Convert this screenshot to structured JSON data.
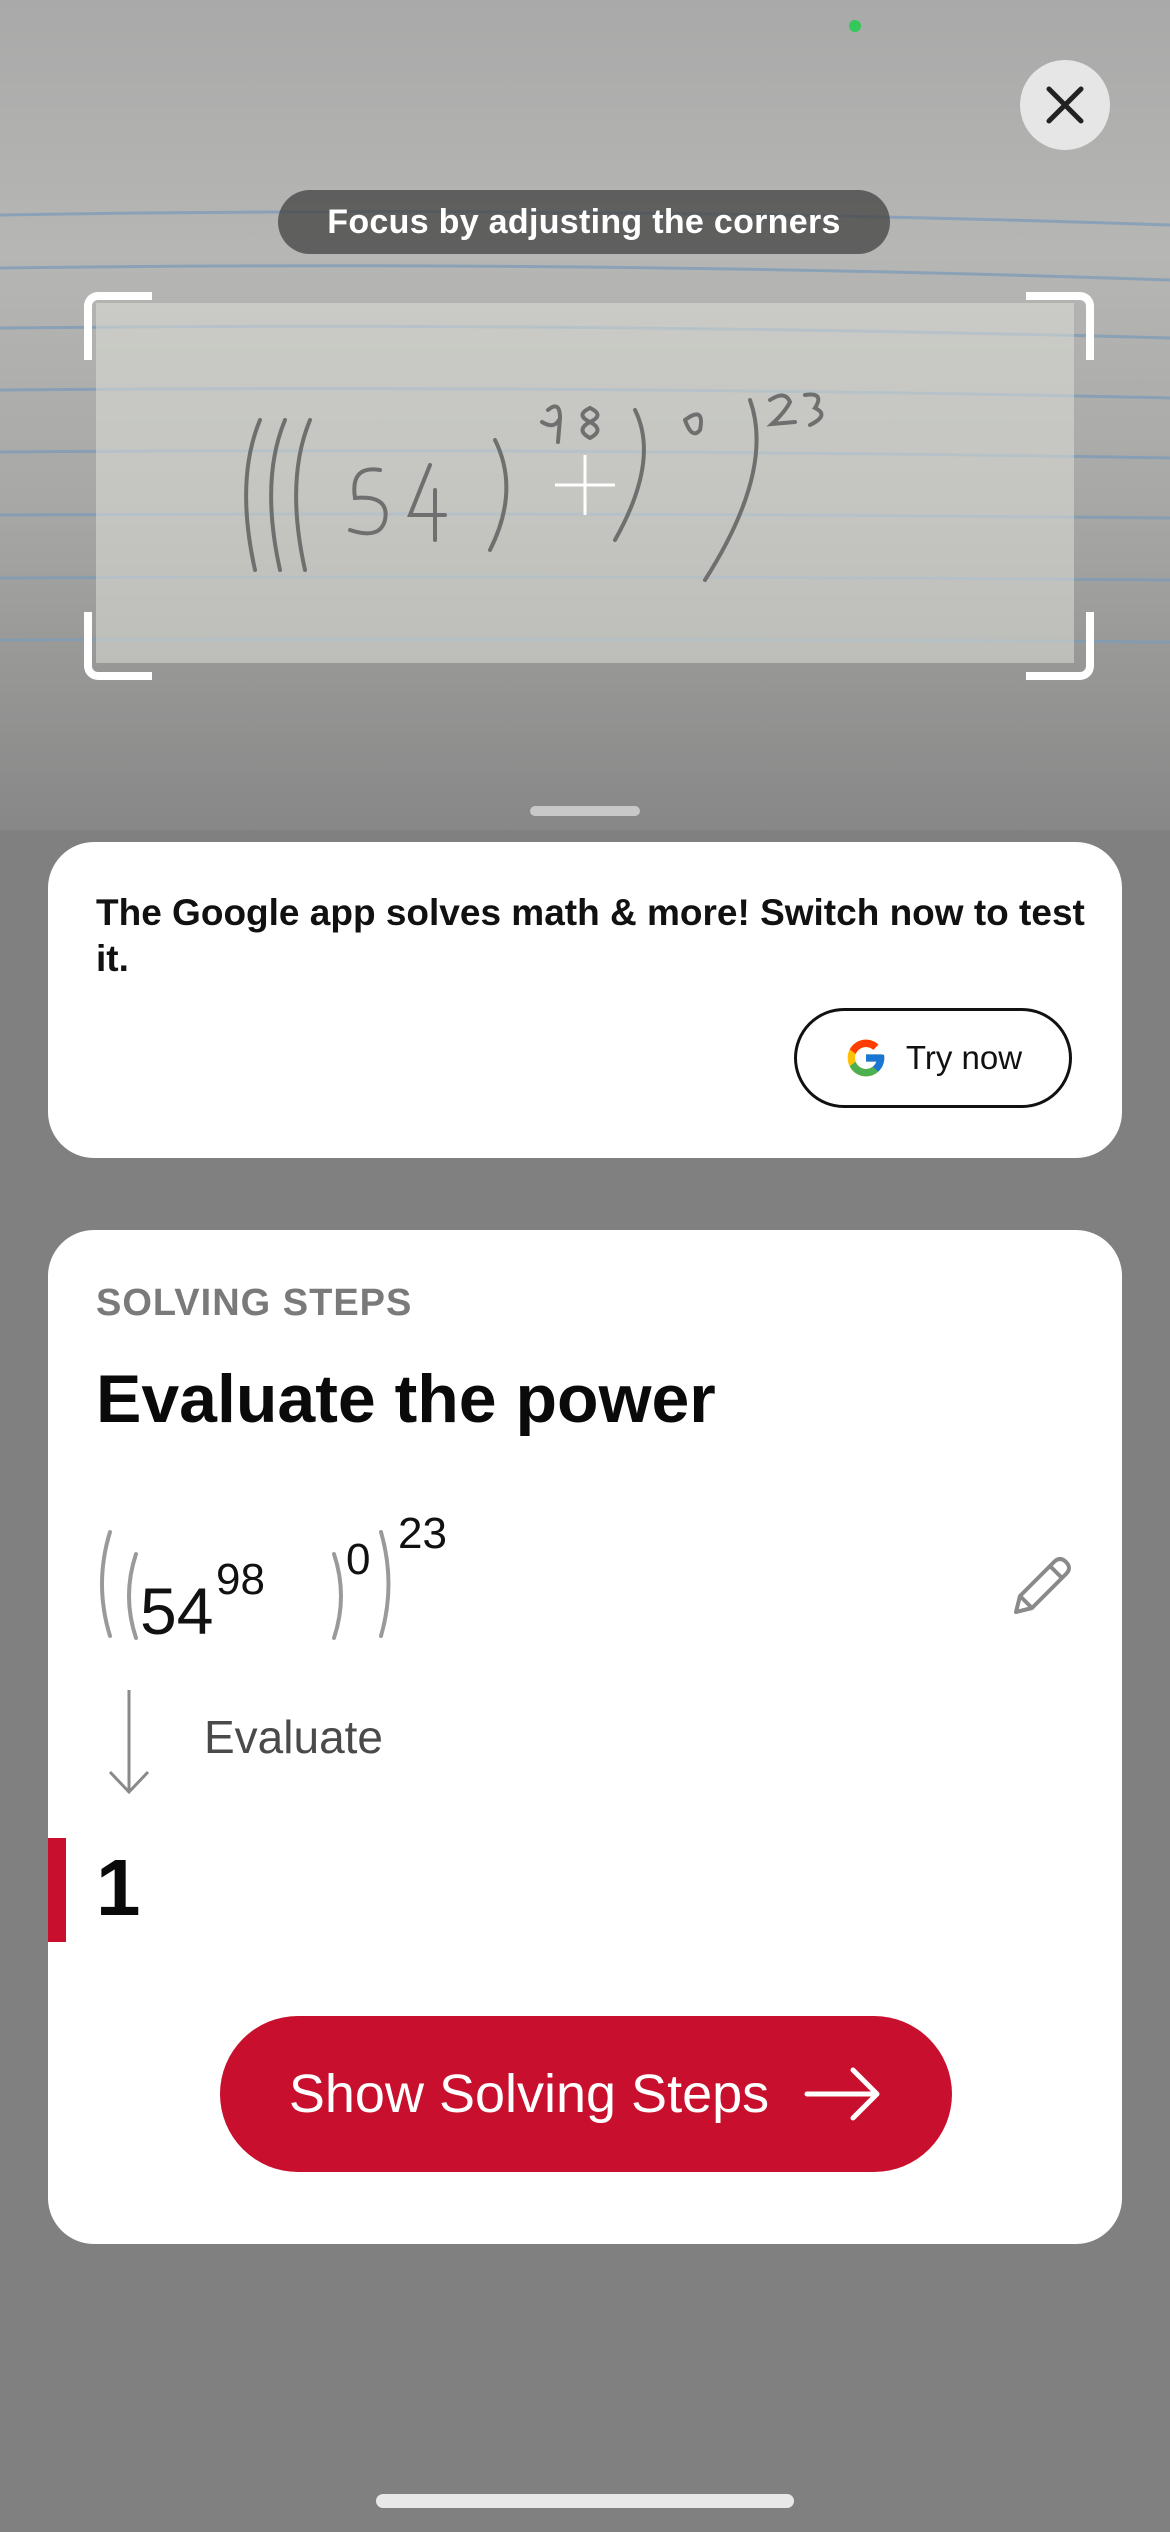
{
  "camera": {
    "focus_hint": "Focus by adjusting the corners",
    "close_icon": "close-icon",
    "status_color": "#34c759"
  },
  "promo": {
    "text": "The Google app solves math & more! Switch now to test it.",
    "button_label": "Try now",
    "button_icon": "google-g-icon"
  },
  "steps": {
    "kicker": "SOLVING STEPS",
    "title": "Evaluate the power",
    "expression": {
      "base": "54",
      "exp1": "98",
      "exp2": "0",
      "exp3": "23"
    },
    "step_label": "Evaluate",
    "result": "1",
    "button_label": "Show Solving Steps",
    "edit_icon": "pencil-icon",
    "accent_color": "#c8102e"
  }
}
